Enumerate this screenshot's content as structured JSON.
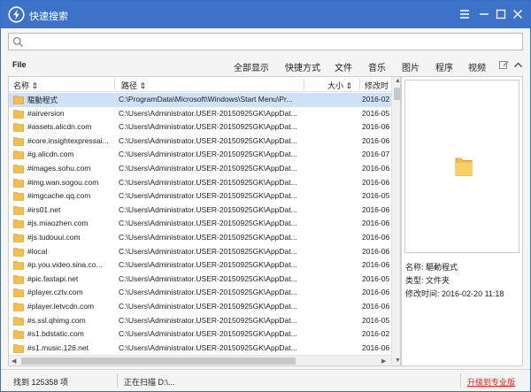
{
  "app": {
    "title": "快速搜索"
  },
  "search": {
    "value": "",
    "placeholder": ""
  },
  "menu": {
    "file": "File"
  },
  "categories": [
    {
      "label": "全部显示",
      "active": true
    },
    {
      "label": "快捷方式"
    },
    {
      "label": "文件"
    },
    {
      "label": "音乐"
    },
    {
      "label": "图片"
    },
    {
      "label": "程序"
    },
    {
      "label": "视频"
    }
  ],
  "columns": {
    "name": "名称",
    "path": "路径",
    "size": "大小",
    "date": "修改时"
  },
  "rows": [
    {
      "name": "驅動程式",
      "path": "C:\\ProgramData\\Microsoft\\Windows\\Start Menu\\Pr...",
      "date": "2016-02",
      "selected": true
    },
    {
      "name": "#airversion",
      "path": "C:\\Users\\Administrator.USER-20150925GK\\AppDat...",
      "date": "2016-05"
    },
    {
      "name": "#assets.alicdn.com",
      "path": "C:\\Users\\Administrator.USER-20150925GK\\AppDat...",
      "date": "2016-06"
    },
    {
      "name": "#core.insightexpressai...",
      "path": "C:\\Users\\Administrator.USER-20150925GK\\AppDat...",
      "date": "2016-06"
    },
    {
      "name": "#g.alicdn.com",
      "path": "C:\\Users\\Administrator.USER-20150925GK\\AppDat...",
      "date": "2016-07"
    },
    {
      "name": "#images.sohu.com",
      "path": "C:\\Users\\Administrator.USER-20150925GK\\AppDat...",
      "date": "2016-06"
    },
    {
      "name": "#img.wan.sogou.com",
      "path": "C:\\Users\\Administrator.USER-20150925GK\\AppDat...",
      "date": "2016-06"
    },
    {
      "name": "#imgcache.qq.com",
      "path": "C:\\Users\\Administrator.USER-20150925GK\\AppDat...",
      "date": "2016-05"
    },
    {
      "name": "#irs01.net",
      "path": "C:\\Users\\Administrator.USER-20150925GK\\AppDat...",
      "date": "2016-06"
    },
    {
      "name": "#js.miaozhen.com",
      "path": "C:\\Users\\Administrator.USER-20150925GK\\AppDat...",
      "date": "2016-06"
    },
    {
      "name": "#js.tudouui.com",
      "path": "C:\\Users\\Administrator.USER-20150925GK\\AppDat...",
      "date": "2016-06"
    },
    {
      "name": "#local",
      "path": "C:\\Users\\Administrator.USER-20150925GK\\AppDat...",
      "date": "2016-06"
    },
    {
      "name": "#p.you.video.sina.co...",
      "path": "C:\\Users\\Administrator.USER-20150925GK\\AppDat...",
      "date": "2016-06"
    },
    {
      "name": "#pic.fastapi.net",
      "path": "C:\\Users\\Administrator.USER-20150925GK\\AppDat...",
      "date": "2016-05"
    },
    {
      "name": "#player.cztv.com",
      "path": "C:\\Users\\Administrator.USER-20150925GK\\AppDat...",
      "date": "2016-06"
    },
    {
      "name": "#player.letvcdn.com",
      "path": "C:\\Users\\Administrator.USER-20150925GK\\AppDat...",
      "date": "2016-06"
    },
    {
      "name": "#s.ssl.qhimg.com",
      "path": "C:\\Users\\Administrator.USER-20150925GK\\AppDat...",
      "date": "2016-05"
    },
    {
      "name": "#s1.bdstatic.com",
      "path": "C:\\Users\\Administrator.USER-20150925GK\\AppDat...",
      "date": "2016-02"
    },
    {
      "name": "#s1.music.126.net",
      "path": "C:\\Users\\Administrator.USER-20150925GK\\AppDat...",
      "date": "2016-06"
    }
  ],
  "preview": {
    "name_label": "名称:",
    "name_value": "驅動程式",
    "type_label": "类型:",
    "type_value": "文件夹",
    "time_label": "修改时间:",
    "time_value": "2016-02-20 11:18"
  },
  "status": {
    "found": "找到 125358 项",
    "scanning": "正在扫描 D:\\...",
    "upgrade": "升级到专业版"
  },
  "colors": {
    "titlebar": "#3c73c9",
    "accent": "#e58a2c",
    "selected_row": "#cfe1f7",
    "upgrade": "#e02020",
    "folder": "#f2c04a"
  },
  "icons": [
    "app-logo-icon",
    "minimize-icon",
    "maximize-icon",
    "close-icon",
    "menu-icon",
    "search-icon",
    "edit-icon",
    "collapse-icon",
    "folder-icon"
  ]
}
